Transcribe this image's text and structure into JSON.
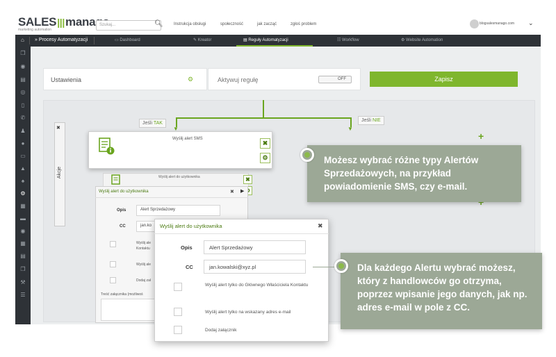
{
  "brand": {
    "name_part1": "SALES",
    "name_part2": "manago",
    "tagline": "marketing automation"
  },
  "header": {
    "search_placeholder": "Szukaj...",
    "links": [
      "Instrukcja obsługi",
      "społeczność",
      "jak zacząć",
      "zgłoś problem"
    ],
    "user": "blogsalesmanago.com"
  },
  "nav": {
    "section": "Procesy Automatyzacji",
    "tabs": [
      "Dashboard",
      "Kreator",
      "Reguły Automatyzacji",
      "Workflow",
      "Website Automation"
    ],
    "active_tab": "Reguły Automatyzacji"
  },
  "rule": {
    "settings_label": "Ustawienia",
    "activate_label": "Aktywuj regułę",
    "toggle_state": "OFF",
    "save_label": "Zapisz"
  },
  "flow": {
    "actions_label": "Akcje",
    "yes_label_prefix": "Jeśli ",
    "yes_label": "TAK",
    "no_label_prefix": "Jeśli ",
    "no_label": "NIE",
    "sms_card_title": "Wyślij alert SMS",
    "user_card_title": "Wyślij alert do użytkownika"
  },
  "form_back": {
    "title": "Wyślij alert do użytkownika",
    "desc_label": "Opis",
    "desc_value": "Alert Sprzedażowy",
    "cc_label": "CC",
    "cc_value": "jan.ko",
    "opt1": "Wyślij ale",
    "opt1b": "Kontaktu",
    "opt2": "Wyślij ale",
    "opt3": "Dodaj zał",
    "attachment_text": "Treść załącznika (możliwoś"
  },
  "form_front": {
    "title": "Wyślij alert do użytkownika",
    "desc_label": "Opis",
    "desc_value": "Alert Sprzedażowy",
    "cc_label": "CC",
    "cc_value": "jan.kowalski@xyz.pl",
    "opt_owner": "Wyślij alert tylko do Głównego Właściciela Kontaktu",
    "opt_email": "Wyślij alert tylko na wskazany adres e-mail",
    "opt_attach": "Dodaj załącznik"
  },
  "tips": {
    "tip1": "Możesz wybrać różne typy Alertów Sprzedażowych, na przykład powiadomienie SMS, czy e-mail.",
    "tip2": "Dla każdego Alertu wybrać możesz, który z handlowców go otrzyma, poprzez wpisanie jego danych, jak np. adres e-mail w pole z CC."
  },
  "colors": {
    "accent": "#7fb62d",
    "nav": "#2e3237",
    "tip": "#9ca896"
  },
  "icons": [
    "search-icon",
    "home-icon",
    "gear-icon",
    "close-icon",
    "document-icon",
    "plus-icon",
    "chevron-down-icon"
  ]
}
